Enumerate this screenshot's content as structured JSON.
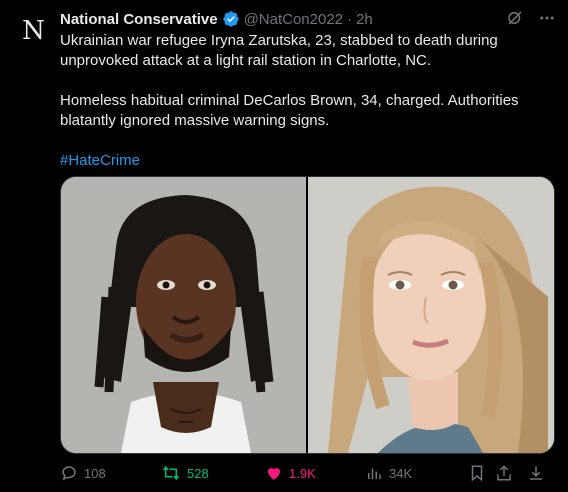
{
  "author": {
    "avatar_letter": "N",
    "name": "National Conservative",
    "handle": "@NatCon2022",
    "separator": "·",
    "time": "2h"
  },
  "post": {
    "paragraph1": "Ukrainian war refugee Iryna Zarutska, 23, stabbed to death during unprovoked attack at a light rail station in Charlotte, NC.",
    "paragraph2": "Homeless habitual criminal DeCarlos Brown, 34, charged. Authorities blatantly ignored massive warning signs.",
    "hashtag": "#HateCrime"
  },
  "media": [
    {
      "description": "mugshot photo"
    },
    {
      "description": "portrait photo"
    }
  ],
  "actions": {
    "replies": "108",
    "reposts": "528",
    "likes": "1.9K",
    "views": "34K"
  },
  "colors": {
    "background": "#000000",
    "text": "#e7e9ea",
    "muted": "#71767b",
    "link": "#1d9bf0",
    "repost_active": "#00ba7c",
    "like_active": "#f91880",
    "verified": "#1d9bf0"
  },
  "icons": [
    "grok-icon",
    "more-icon",
    "reply-icon",
    "repost-icon",
    "like-icon",
    "views-icon",
    "bookmark-icon",
    "share-icon",
    "download-icon",
    "verified-badge-icon"
  ]
}
